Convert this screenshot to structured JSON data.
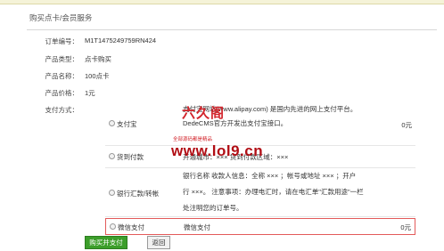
{
  "header": {
    "title": "购买点卡/会员服务"
  },
  "order": {
    "order_no_label": "订单编号：",
    "order_no_value": "M1T1475249759RN424",
    "type_label": "产品类型：",
    "type_value": "点卡购买",
    "name_label": "产品名称：",
    "name_value": "100点卡",
    "price_label": "产品价格：",
    "price_value": "1元",
    "method_label": "支付方式："
  },
  "payments": [
    {
      "name": "支付宝",
      "desc_line1": "支付宝网站(www.alipay.com) 是国内先进的网上支付平台。",
      "desc_line2": "DedeCMS官方开发出支付宝接口。",
      "price": "0元"
    },
    {
      "name": "货到付款",
      "desc_line1": "开通城市：×××  货到付款区域：×××",
      "price": "0元"
    },
    {
      "name": "银行汇款/转帐",
      "desc_line1": "银行名称 收款人信息：全称 ××× ；帐号或地址 ××× ；开户",
      "desc_line2": "行 ×××。 注意事项：办理电汇时，请在电汇单\"汇款用途\"一栏",
      "desc_line3": "处注明您的订单号。",
      "price": "0元"
    },
    {
      "name": "微信支付",
      "desc_line1": "微信支付",
      "price": "0元"
    }
  ],
  "watermark": {
    "logo": "六久阁",
    "small": "全部源码都是精品",
    "url": "www.lol9.cn"
  },
  "buttons": {
    "buy_label": "购买并支付",
    "back_label": "返回"
  }
}
